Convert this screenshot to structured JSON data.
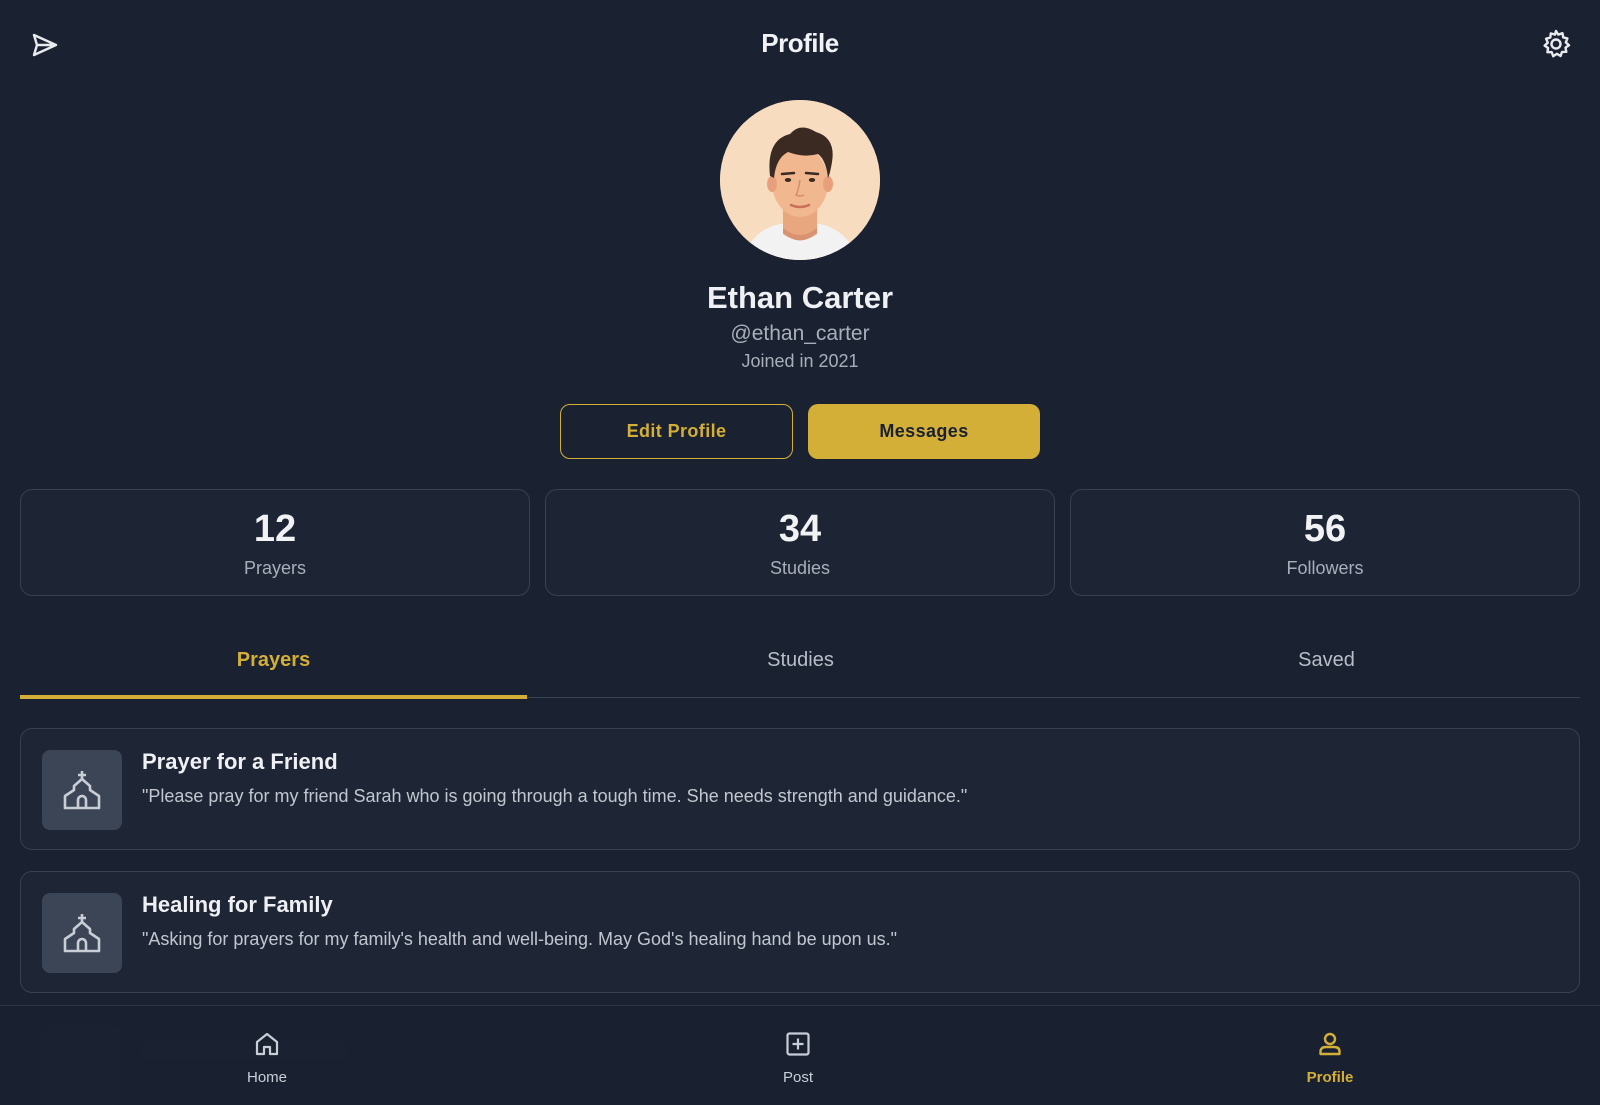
{
  "header": {
    "title": "Profile"
  },
  "profile": {
    "name": "Ethan Carter",
    "handle": "@ethan_carter",
    "joined": "Joined in 2021"
  },
  "actions": {
    "edit_label": "Edit Profile",
    "messages_label": "Messages"
  },
  "stats": [
    {
      "value": "12",
      "label": "Prayers"
    },
    {
      "value": "34",
      "label": "Studies"
    },
    {
      "value": "56",
      "label": "Followers"
    }
  ],
  "tabs": [
    {
      "label": "Prayers",
      "active": true
    },
    {
      "label": "Studies",
      "active": false
    },
    {
      "label": "Saved",
      "active": false
    }
  ],
  "posts": [
    {
      "icon": "church-icon",
      "title": "Prayer for a Friend",
      "text": "\"Please pray for my friend Sarah who is going through a tough time. She needs strength and guidance.\""
    },
    {
      "icon": "church-icon",
      "title": "Healing for Family",
      "text": "\"Asking for prayers for my family's health and well-being. May God's healing hand be upon us.\""
    }
  ],
  "nav": [
    {
      "label": "Home",
      "icon": "home-icon",
      "active": false
    },
    {
      "label": "Post",
      "icon": "plus-square-icon",
      "active": false
    },
    {
      "label": "Profile",
      "icon": "person-icon",
      "active": true
    }
  ],
  "colors": {
    "background": "#1a2130",
    "accent": "#d4af37",
    "card": "#1e2535",
    "border": "#374152"
  }
}
